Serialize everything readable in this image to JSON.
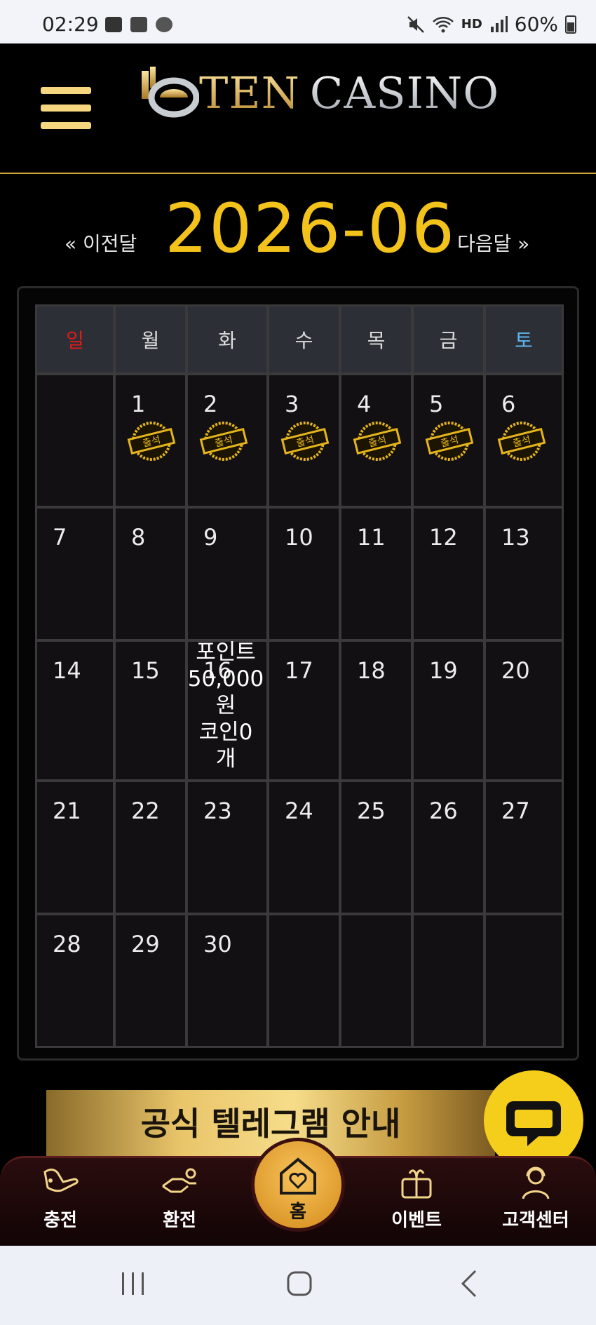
{
  "status_bar": {
    "time": "02:29",
    "network": "HD",
    "battery": "60%"
  },
  "header": {
    "logo_ten": "TEN",
    "logo_casino": "CASINO"
  },
  "month_nav": {
    "prev_label": "« 이전달",
    "title": "2026-06",
    "next_label": "다음달 »"
  },
  "calendar": {
    "weekdays": [
      "일",
      "월",
      "화",
      "수",
      "목",
      "금",
      "토"
    ],
    "weeks": [
      [
        "",
        "1",
        "2",
        "3",
        "4",
        "5",
        "6"
      ],
      [
        "7",
        "8",
        "9",
        "10",
        "11",
        "12",
        "13"
      ],
      [
        "14",
        "15",
        "16",
        "17",
        "18",
        "19",
        "20"
      ],
      [
        "21",
        "22",
        "23",
        "24",
        "25",
        "26",
        "27"
      ],
      [
        "28",
        "29",
        "30",
        "",
        "",
        "",
        ""
      ]
    ],
    "stamp_label": "출석",
    "tooltip": {
      "line1": "포인트",
      "line2": "50,000",
      "line3": "원",
      "line4": "코인0",
      "line5": "개"
    }
  },
  "banner": {
    "text": "공식 텔레그램 안내"
  },
  "bottom_nav": {
    "deposit": "충전",
    "withdraw": "환전",
    "home": "홈",
    "event": "이벤트",
    "support": "고객센터"
  },
  "colors": {
    "gold": "#f3c31b",
    "sunday": "#e11a1a",
    "saturday": "#5fb8f2",
    "accent_line": "#c9a43c"
  }
}
